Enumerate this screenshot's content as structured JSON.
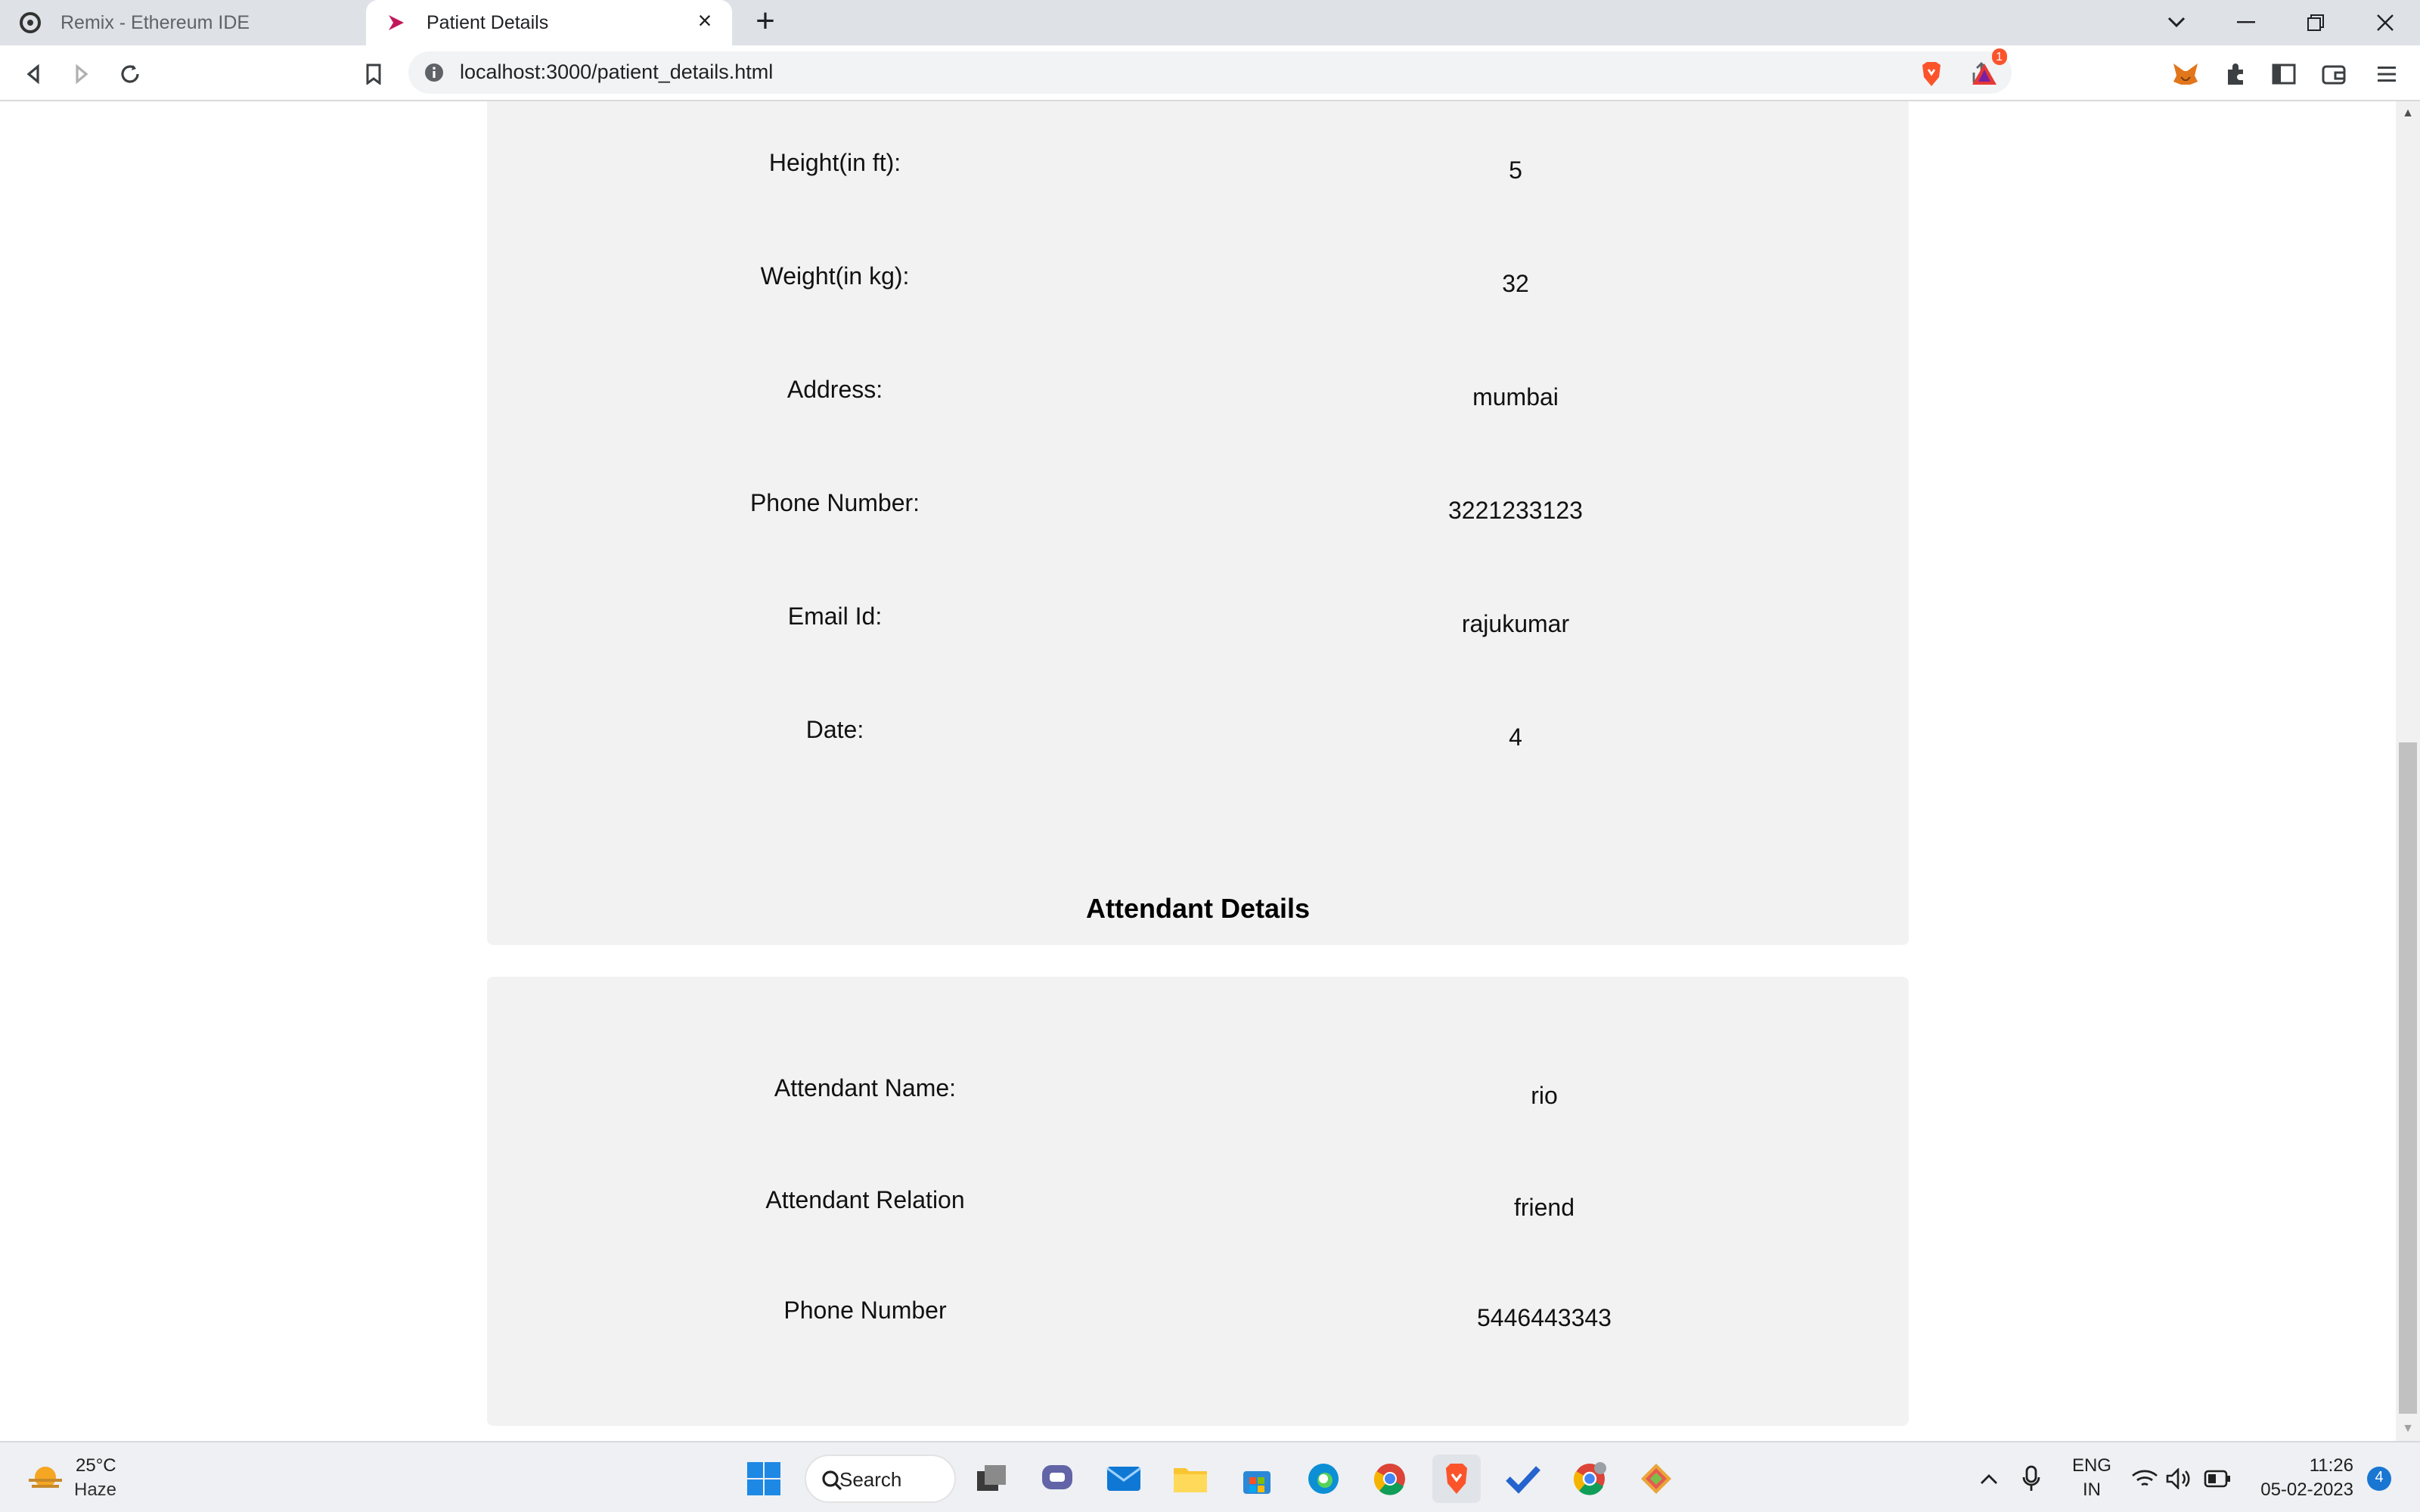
{
  "browser": {
    "tabs": [
      {
        "title": "Remix - Ethereum IDE",
        "active": false
      },
      {
        "title": "Patient Details",
        "active": true
      }
    ],
    "url": "localhost:3000/patient_details.html",
    "notification_count": "1"
  },
  "patient": {
    "rows": [
      {
        "label": "Height(in ft):",
        "value": "5"
      },
      {
        "label": "Weight(in kg):",
        "value": "32"
      },
      {
        "label": "Address:",
        "value": "mumbai"
      },
      {
        "label": "Phone Number:",
        "value": "3221233123"
      },
      {
        "label": "Email Id:",
        "value": "rajukumar"
      },
      {
        "label": "Date:",
        "value": "4"
      }
    ]
  },
  "attendant": {
    "title": "Attendant Details",
    "rows": [
      {
        "label": "Attendant Name:",
        "value": "rio"
      },
      {
        "label": "Attendant Relation",
        "value": "friend"
      },
      {
        "label": "Phone Number",
        "value": "5446443343"
      }
    ]
  },
  "taskbar": {
    "weather_temp": "25°C",
    "weather_desc": "Haze",
    "search_label": "Search",
    "lang_top": "ENG",
    "lang_bottom": "IN",
    "time": "11:26",
    "date": "05-02-2023",
    "notification_badge": "4"
  },
  "colors": {
    "card_bg": "#f2f2f2",
    "tabstrip_bg": "#dee1e6",
    "brave_orange": "#fb542b"
  }
}
